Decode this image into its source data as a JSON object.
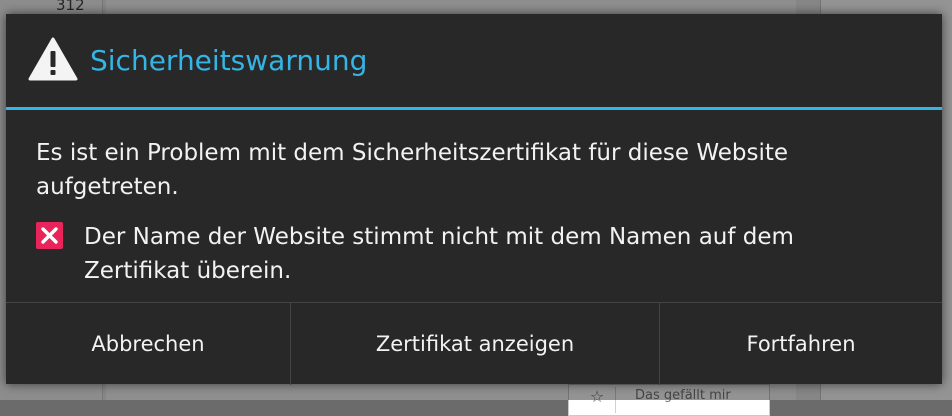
{
  "background": {
    "count": "312",
    "like_text": "Das gefällt mir"
  },
  "dialog": {
    "title": "Sicherheitswarnung",
    "icon": "warning-icon",
    "message": "Es ist ein Problem mit dem Sicherheitszertifikat für diese Website aufgetreten.",
    "error": {
      "icon": "error-x-icon",
      "text": "Der Name der Website stimmt nicht mit dem Namen auf dem Zertifikat überein."
    },
    "buttons": {
      "cancel": "Abbrechen",
      "view_certificate": "Zertifikat anzeigen",
      "continue": "Fortfahren"
    }
  },
  "colors": {
    "accent": "#33b5e5",
    "dialog_bg": "#282828",
    "error": "#e8245a",
    "text": "#f2f2f2"
  }
}
